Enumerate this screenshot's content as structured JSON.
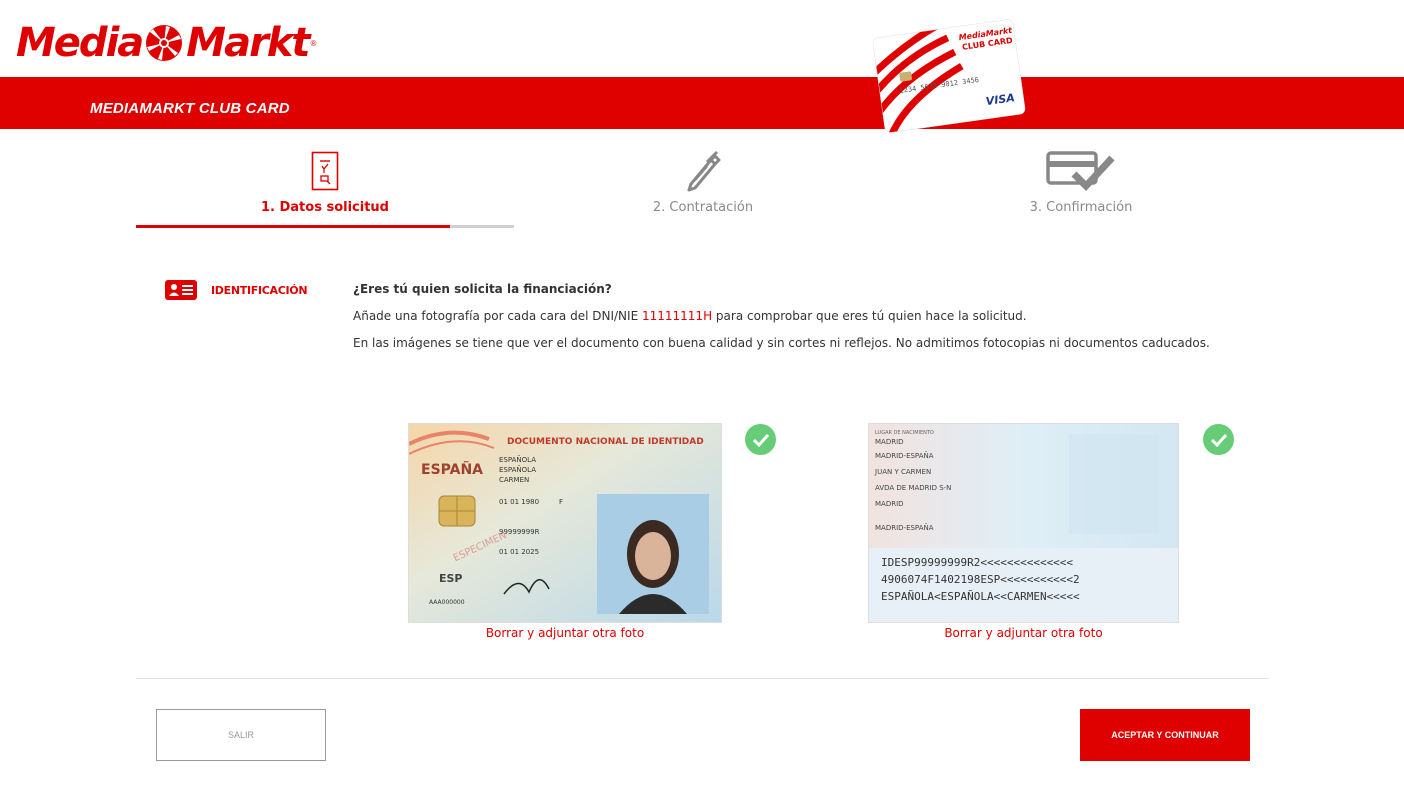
{
  "brand": {
    "logo_left": "Media",
    "logo_right": "Markt",
    "logo_reg": "®",
    "band_title": "MEDIAMARKT CLUB CARD",
    "card": {
      "brand_small": "MediaMarkt",
      "name": "CLUB CARD",
      "number": "1234 5678 9012 3456",
      "network": "VISA"
    }
  },
  "steps": [
    {
      "label": "1. Datos solicitud",
      "active": true,
      "icon": "form-document-icon"
    },
    {
      "label": "2. Contratación",
      "active": false,
      "icon": "pen-icon"
    },
    {
      "label": "3. Confirmación",
      "active": false,
      "icon": "card-check-icon"
    }
  ],
  "progress": {
    "fraction": 0.83
  },
  "identification": {
    "section_label": "IDENTIFICACIÓN",
    "question": "¿Eres tú quien solicita la financiación?",
    "line1_pre": "Añade una fotografía por cada cara del DNI/NIE",
    "dni": "11111111H",
    "line1_post": "para comprobar que eres tú quien hace la solicitud.",
    "line2": "En las imágenes se tiene que ver el documento con buena calidad y sin cortes ni reflejos. No admitimos fotocopias ni documentos caducados."
  },
  "documents": {
    "front": {
      "header": "DOCUMENTO NACIONAL DE IDENTIDAD",
      "country": "ESPAÑA",
      "surname1": "ESPAÑOLA",
      "surname2": "ESPAÑOLA",
      "name": "CARMEN",
      "sex": "F",
      "birth": "01 01 1980",
      "nationality": "ESP",
      "number": "99999999R",
      "support": "AAA000000",
      "validity": "01 01 2025",
      "stamp": "ESPECIMEN",
      "status": "uploaded"
    },
    "back": {
      "place_birth_label": "LUGAR DE NACIMIENTO",
      "place_birth": "MADRID",
      "province": "MADRID-ESPAÑA",
      "parents": "JUAN Y CARMEN",
      "address": "AVDA DE MADRID S-N",
      "city": "MADRID",
      "province2": "MADRID-ESPAÑA",
      "mrz1": "IDESP99999999R2<<<<<<<<<<<<<<",
      "mrz2": "4906074F1402198ESP<<<<<<<<<<<2",
      "mrz3": "ESPAÑOLA<ESPAÑOLA<<CARMEN<<<<<",
      "status": "uploaded"
    },
    "front_link": "Borrar y adjuntar otra foto",
    "back_link": "Borrar y adjuntar otra foto"
  },
  "buttons": {
    "exit": "SALIR",
    "continue": "ACEPTAR Y CONTINUAR"
  },
  "colors": {
    "brand_red": "#df0000",
    "success_green": "#66cc77"
  }
}
